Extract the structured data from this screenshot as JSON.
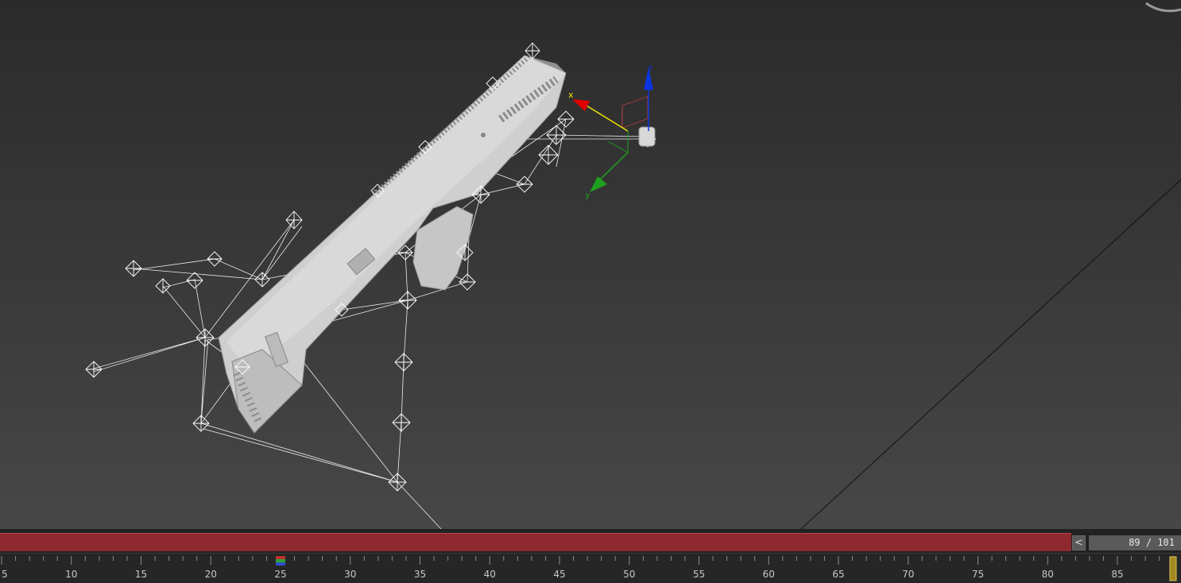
{
  "viewport": {
    "gizmo": {
      "x_label": "x",
      "y_label": "y",
      "z_label": "z"
    },
    "colors": {
      "x_axis": "#e00000",
      "y_axis": "#1ea01e",
      "z_axis": "#0a35e0",
      "x_label": "#f0e000"
    }
  },
  "animation": {
    "prev_button_icon": "chevron-left-icon",
    "prev_button_glyph": "<",
    "frame_display": "89 / 101",
    "current_frame": 89,
    "total_frames": 101
  },
  "timeline": {
    "labels": [
      "5",
      "10",
      "15",
      "20",
      "25",
      "30",
      "35",
      "40",
      "45",
      "50",
      "55",
      "60",
      "65",
      "70",
      "75",
      "80",
      "85"
    ],
    "key_frame": 25,
    "playhead_frame": 89
  }
}
